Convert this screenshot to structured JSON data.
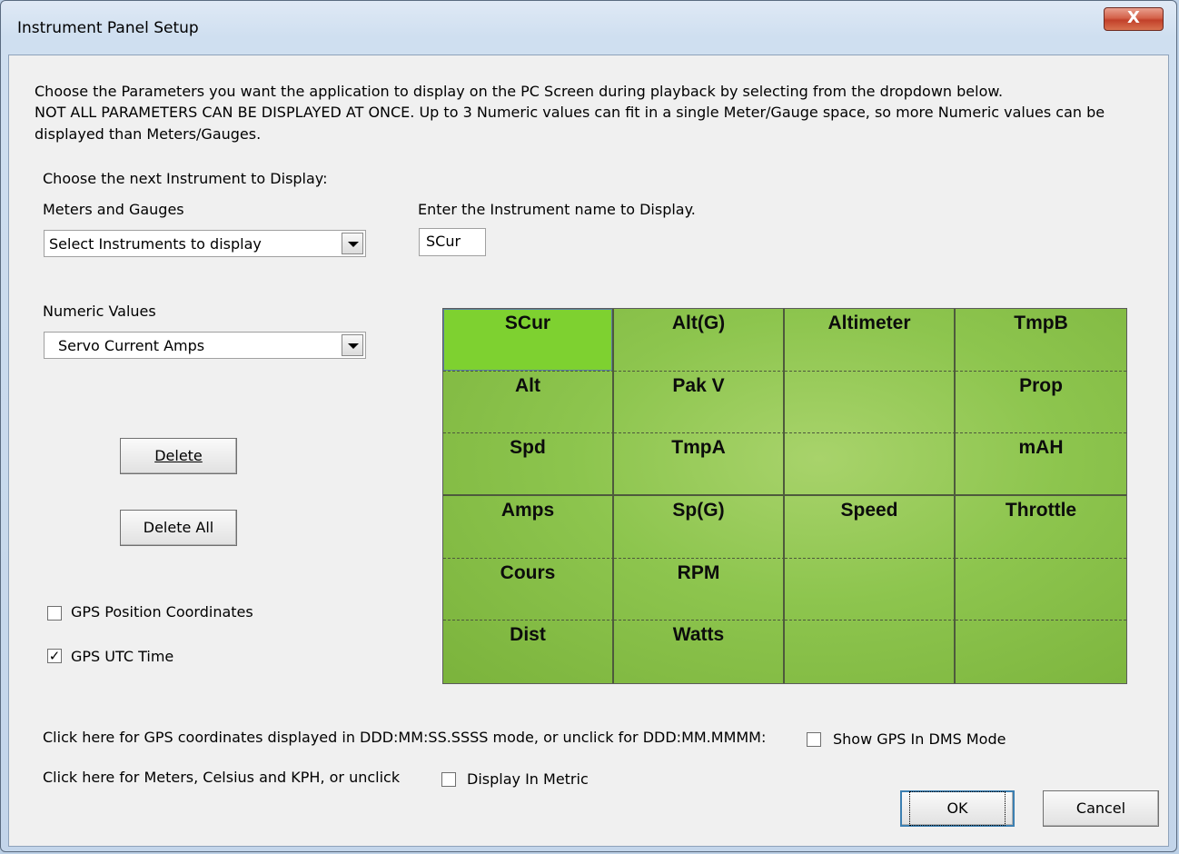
{
  "window": {
    "title": "Instrument Panel Setup",
    "close_glyph": "X"
  },
  "intro": {
    "line1": "Choose the Parameters  you want the application to display on the PC Screen during playback by selecting from the dropdown below.",
    "line2": "NOT ALL PARAMETERS CAN BE DISPLAYED AT ONCE.  Up to 3 Numeric values can fit in a single Meter/Gauge space, so more Numeric values can be displayed than Meters/Gauges."
  },
  "left": {
    "choose_label": "Choose the next Instrument to Display:",
    "meters_label": "Meters and Gauges",
    "meters_value": "Select Instruments to display",
    "numeric_label": "Numeric Values",
    "numeric_value": "Servo Current Amps",
    "delete_label": "Delete",
    "delete_all_label": "Delete All",
    "gps_position": {
      "label": "GPS Position Coordinates",
      "checked": false
    },
    "gps_utc": {
      "label": "GPS UTC Time",
      "checked": true
    }
  },
  "name_entry": {
    "label": "Enter the Instrument name to Display.",
    "value": "SCur"
  },
  "instrument_grid": {
    "rows": [
      [
        "SCur",
        "Alt(G)",
        "Altimeter",
        "TmpB"
      ],
      [
        "Alt",
        "Pak V",
        "",
        "Prop"
      ],
      [
        "Spd",
        "TmpA",
        "",
        "mAH"
      ],
      [
        "Amps",
        "Sp(G)",
        "Speed",
        "Throttle"
      ],
      [
        "Cours",
        "RPM",
        "",
        ""
      ],
      [
        "Dist",
        "Watts",
        "",
        ""
      ]
    ],
    "selected": "SCur"
  },
  "bottom": {
    "dms_text": "Click here for GPS coordinates displayed in DDD:MM:SS.SSSS mode, or unclick for DDD:MM.MMMM:",
    "dms_checkbox": {
      "label": "Show GPS In DMS Mode",
      "checked": false
    },
    "metric_text": "Click here for Meters, Celsius and KPH, or unclick",
    "metric_checkbox": {
      "label": "Display In Metric",
      "checked": false
    },
    "ok_label": "OK",
    "cancel_label": "Cancel"
  }
}
